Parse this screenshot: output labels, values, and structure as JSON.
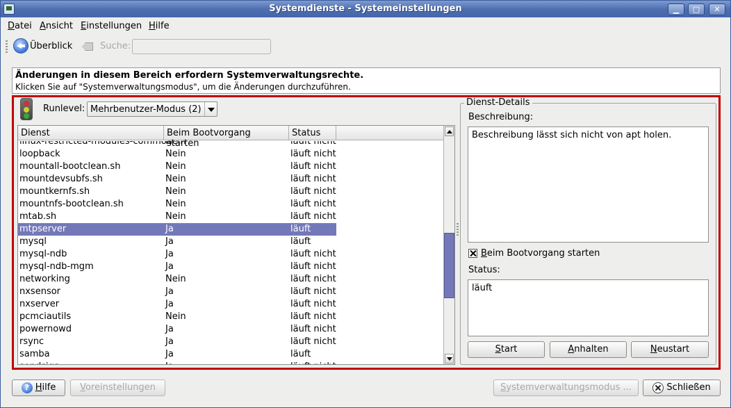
{
  "window": {
    "title": "Systemdienste - Systemeinstellungen",
    "minimize_glyph": "▁",
    "maximize_glyph": "□",
    "close_glyph": "✕"
  },
  "menu": {
    "items": [
      {
        "accesskey": "D",
        "rest": "atei"
      },
      {
        "accesskey": "A",
        "rest": "nsicht"
      },
      {
        "accesskey": "E",
        "rest": "instellungen"
      },
      {
        "accesskey": "H",
        "rest": "ilfe"
      }
    ]
  },
  "toolbar": {
    "overview_label": "Überblick",
    "search_label": "Suche:",
    "search_value": "",
    "back_icon": "go-back-icon",
    "clear_icon": "clear-search-icon"
  },
  "notice": {
    "line1": "Änderungen in diesem Bereich erfordern Systemverwaltungsrechte.",
    "line2": "Klicken Sie auf \"Systemverwaltungsmodus\", um die Änderungen durchzuführen."
  },
  "runlevel": {
    "label": "Runlevel:",
    "selected": "Mehrbenutzer-Modus (2)",
    "icon": "traffic-light-icon"
  },
  "table": {
    "columns": [
      "Dienst",
      "Beim Bootvorgang starten",
      "Status"
    ],
    "selected_index": 7,
    "rows": [
      [
        "linux-restricted-modules-common",
        "Nein",
        "läuft nicht"
      ],
      [
        "loopback",
        "Nein",
        "läuft nicht"
      ],
      [
        "mountall-bootclean.sh",
        "Nein",
        "läuft nicht"
      ],
      [
        "mountdevsubfs.sh",
        "Nein",
        "läuft nicht"
      ],
      [
        "mountkernfs.sh",
        "Nein",
        "läuft nicht"
      ],
      [
        "mountnfs-bootclean.sh",
        "Nein",
        "läuft nicht"
      ],
      [
        "mtab.sh",
        "Nein",
        "läuft nicht"
      ],
      [
        "mtpserver",
        "Ja",
        "läuft"
      ],
      [
        "mysql",
        "Ja",
        "läuft"
      ],
      [
        "mysql-ndb",
        "Ja",
        "läuft nicht"
      ],
      [
        "mysql-ndb-mgm",
        "Ja",
        "läuft nicht"
      ],
      [
        "networking",
        "Nein",
        "läuft nicht"
      ],
      [
        "nxsensor",
        "Ja",
        "läuft nicht"
      ],
      [
        "nxserver",
        "Ja",
        "läuft nicht"
      ],
      [
        "pcmciautils",
        "Nein",
        "läuft nicht"
      ],
      [
        "powernowd",
        "Ja",
        "läuft nicht"
      ],
      [
        "rsync",
        "Ja",
        "läuft nicht"
      ],
      [
        "samba",
        "Ja",
        "läuft"
      ],
      [
        "sendsigs",
        "Ja",
        "läuft nicht"
      ]
    ]
  },
  "details": {
    "group_title": "Dienst-Details",
    "description_label": "Beschreibung:",
    "description_text": "Beschreibung lässt sich nicht von apt holen.",
    "start_at_boot_label_key": "B",
    "start_at_boot_label_rest": "eim Bootvorgang starten",
    "start_at_boot_checked": true,
    "status_label": "Status:",
    "status_text": "läuft",
    "buttons": {
      "start_key": "S",
      "start_rest": "tart",
      "stop_key": "A",
      "stop_rest": "nhalten",
      "restart_key": "N",
      "restart_rest": "eustart"
    }
  },
  "footer": {
    "help_key": "H",
    "help_rest": "ilfe",
    "defaults_key": "V",
    "defaults_rest": "oreinstellungen",
    "admin_mode_key": "S",
    "admin_mode_rest": "ystemverwaltungsmodus ...",
    "close_label": "Schließen",
    "close_key": "e"
  },
  "colors": {
    "selection": "#7378b8",
    "highlight_frame": "#c00000",
    "titlebar": "#4e6eb0"
  }
}
